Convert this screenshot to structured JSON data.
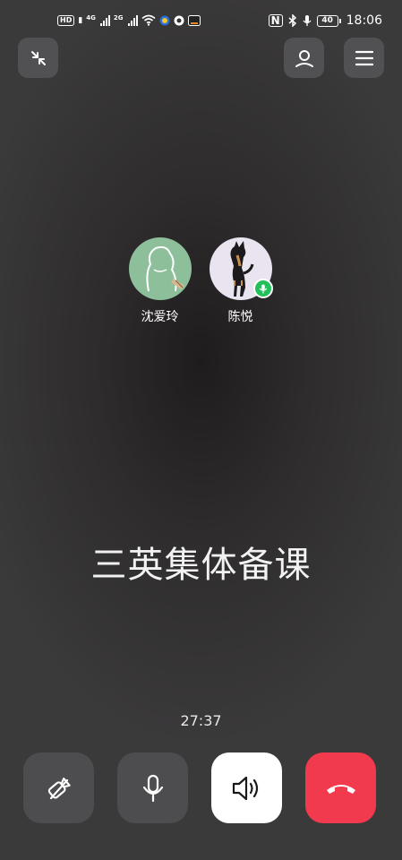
{
  "status_bar": {
    "hd_label": "HD",
    "net1": "4G",
    "net2": "2G",
    "nfc": "N",
    "battery": "40",
    "time": "18:06"
  },
  "top_bar": {
    "minimize_icon": "minimize-arrows-icon",
    "contacts_icon": "person-icon",
    "menu_icon": "hamburger-menu-icon"
  },
  "participants": [
    {
      "name": "沈爱玲",
      "avatar": "green-figure-avatar",
      "speaking": false
    },
    {
      "name": "陈悦",
      "avatar": "dog-photo-avatar",
      "speaking": true
    }
  ],
  "meeting": {
    "title": "三英集体备课",
    "duration": "27:37"
  },
  "controls": {
    "camera_icon": "camera-off-icon",
    "mic_icon": "microphone-icon",
    "speaker_icon": "speaker-icon",
    "hangup_icon": "hang-up-icon",
    "colors": {
      "dark_button": "#4d4c4e",
      "speaker_button": "#ffffff",
      "hangup_button": "#f23a4e",
      "speaking_badge": "#22c05a"
    }
  }
}
